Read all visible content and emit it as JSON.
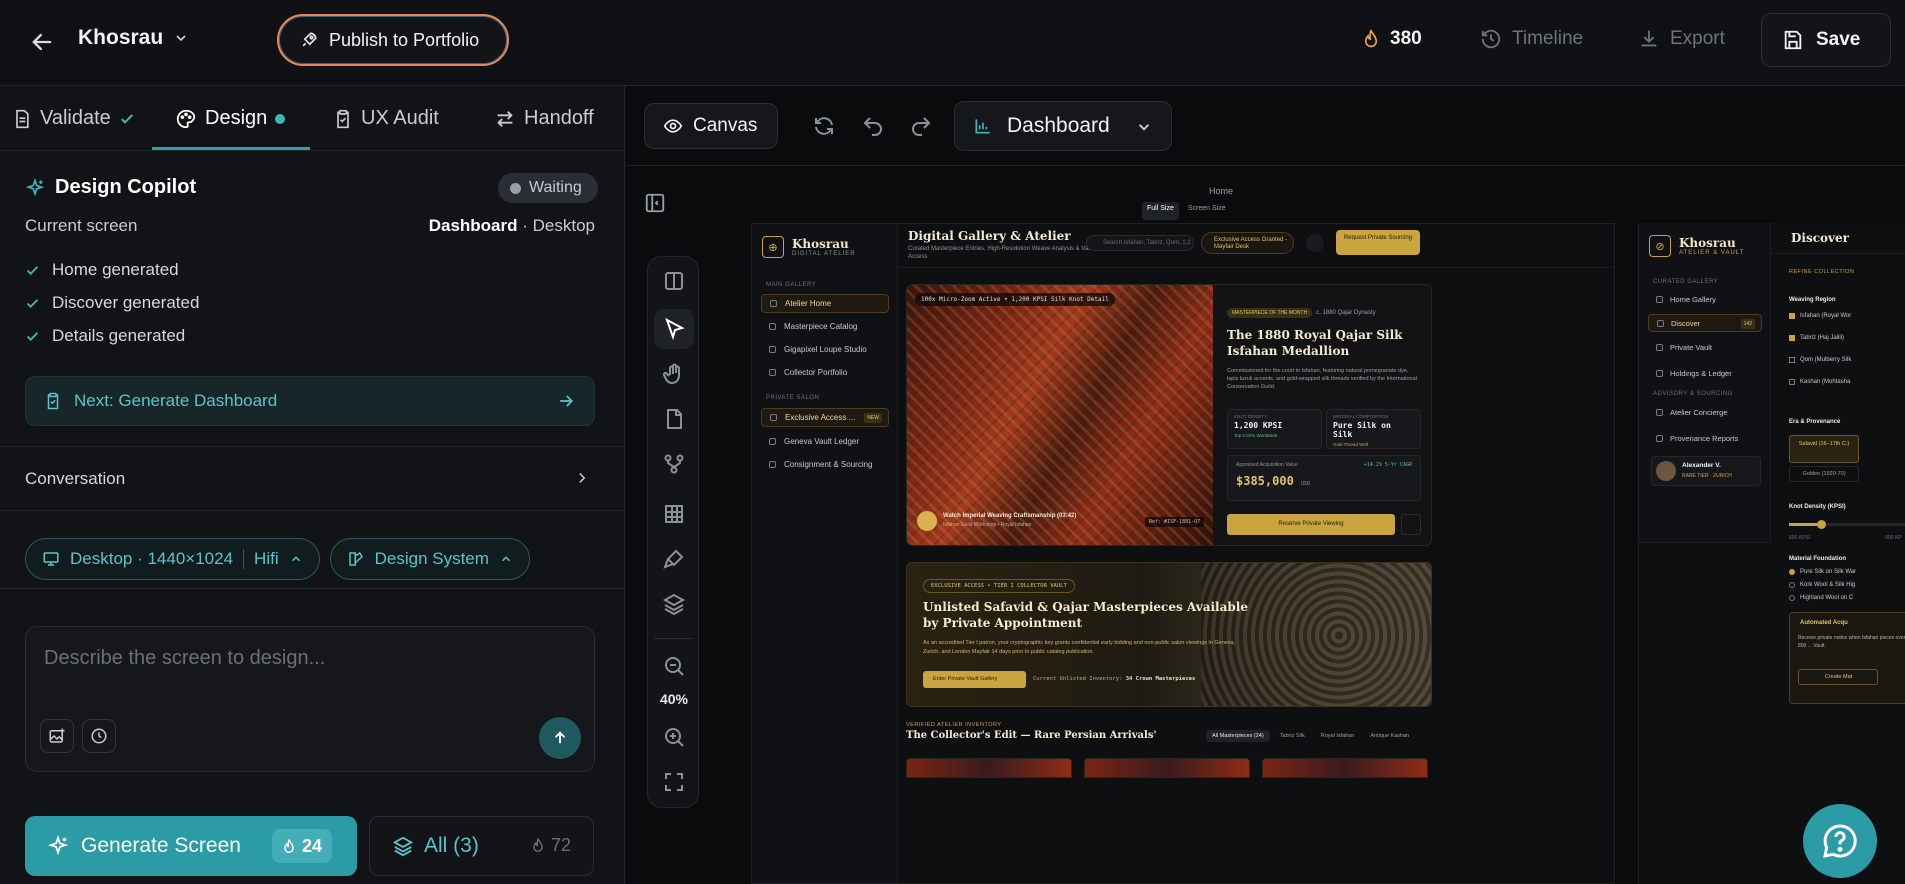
{
  "topbar": {
    "project_name": "Khosrau",
    "publish_label": "Publish to Portfolio",
    "credits": "380",
    "timeline_label": "Timeline",
    "export_label": "Export",
    "save_label": "Save"
  },
  "tabs": [
    {
      "label": "Validate",
      "state": "done"
    },
    {
      "label": "Design",
      "state": "active"
    },
    {
      "label": "UX Audit",
      "state": ""
    },
    {
      "label": "Handoff",
      "state": ""
    }
  ],
  "copilot": {
    "title": "Design Copilot",
    "status": "Waiting",
    "current_screen_label": "Current screen",
    "current_screen_name": "Dashboard",
    "current_screen_device": " · Desktop",
    "steps": [
      "Home generated",
      "Discover generated",
      "Details generated"
    ],
    "next_label": "Next: Generate Dashboard"
  },
  "conversation_label": "Conversation",
  "chips": {
    "device": "Desktop · 1440×1024",
    "fidelity": "Hifi",
    "design_system": "Design System"
  },
  "prompt": {
    "placeholder": "Describe the screen to design..."
  },
  "generate": {
    "label": "Generate Screen",
    "cost": "24"
  },
  "all": {
    "label": "All (3)",
    "cost": "72"
  },
  "canvas": {
    "canvas_label": "Canvas",
    "screen_select": "Dashboard",
    "zoom": "40%",
    "frame_name": "Home",
    "frame_sizes": [
      "Full Size",
      "Screen Size"
    ]
  },
  "mock_home": {
    "brand": "Khosrau",
    "brand_sub": "DIGITAL ATELIER",
    "section_main": "MAIN GALLERY",
    "nav_main": [
      "Atelier Home",
      "Masterpiece Catalog",
      "Gigapixel Loupe Studio",
      "Collector Portfolio"
    ],
    "section_private": "PRIVATE SALON",
    "nav_private": [
      "Exclusive Access ...",
      "Geneva Vault Ledger",
      "Consignment & Sourcing"
    ],
    "private_tag": "NEW",
    "title": "Digital Gallery & Atelier",
    "subtitle": "Curated Masterpiece Entries, High-Resolution Weave Analysis & Vault Access",
    "search_placeholder": "Search Isfahan, Tabriz, Qum, 1,2",
    "exclusive_badge": "Exclusive Access Granted - Mayfair Desk",
    "request_btn": "Request Private Sourcing",
    "hero_badge": "100x Micro-Zoom Active • 1,200 KPSI Silk Knot Detail",
    "hero_pill": "MASTERPIECE OF THE MONTH",
    "hero_era": "c. 1880 Qajar Dynasty",
    "hero_title": "The 1880 Royal Qajar Silk Isfahan Medallion",
    "hero_desc": "Commissioned for the court in Isfahan, featuring natural pomegranate dye, lapis lazuli accents, and gold-wrapped silk threads verified by the International Conservation Guild.",
    "stat1_label": "KNOT DENSITY",
    "stat1_value": "1,200 KPSI",
    "stat1_sub": "Top 0.01% Worldwide",
    "stat2_label": "MATERIAL COMPOSITION",
    "stat2_value": "Pure Silk on Silk",
    "stat2_sub": "Gold Thread Weft",
    "value_label": "Appraised Acquisition Value",
    "value_cagr": "+14.2% 5-Yr CAGR",
    "value_amount": "$385,000",
    "value_unit": "USD",
    "reserve_btn": "Reserve Private Viewing",
    "video_title": "Watch Imperial Weaving Craftsmanship (03:42)",
    "video_sub": "Isfahan Guild Workshop • Royal Isfahan",
    "ref": "Ref: #ISF-1881-Q7",
    "promo_tag": "EXCLUSIVE ACCESS • TIER I COLLECTOR VAULT",
    "promo_title": "Unlisted Safavid & Qajar Masterpieces Available by Private Appointment",
    "promo_desc": "As an accredited Tier I patron, your cryptographic key grants confidential early bidding and non-public salon viewings in Geneva, Zurich, and London Mayfair 14 days prior to public catalog publication.",
    "promo_btn": "Enter Private Vault Gallery",
    "promo_inv_label": "Current Unlisted Inventory:",
    "promo_inv_value": "34 Crown Masterpieces",
    "verified_label": "VERIFIED ATELIER INVENTORY",
    "edit_title": "The Collector's Edit — Rare Persian Arrivals'",
    "filters": [
      "All Masterpieces (24)",
      "Tabriz Silk",
      "Royal Isfahan",
      "Antique Kashan"
    ]
  },
  "mock_discover": {
    "brand": "Khosrau",
    "brand_sub": "ATELIER & VAULT",
    "section_curated": "CURATED GALLERY",
    "nav_curated": [
      "Home Gallery",
      "Discover",
      "Private Vault",
      "Holdings & Ledger"
    ],
    "discover_tag": "142",
    "section_advisory": "ADVISORY & SOURCING",
    "nav_advisory": [
      "Atelier Concierge",
      "Provenance Reports"
    ],
    "user_name": "Alexander V.",
    "user_tier": "RARE TIER · ZURICH",
    "title": "Discover",
    "refine": "REFINE COLLECTION",
    "weaving_region": "Weaving Region",
    "regions": [
      "Isfahan (Royal Wor",
      "Tabriz (Haj Jalili)",
      "Qom (Mulberry Silk",
      "Kashan (Mohtasha"
    ],
    "era_label": "Era & Provenance",
    "era_selected": "Safavid (16–17th C.)",
    "era_other": "Golden (1920-70)",
    "knot_label": "Knot Density (KPSI)",
    "knot_min": "600 KPSI",
    "knot_max": "800 KP",
    "material_label": "Material Foundation",
    "materials": [
      "Pure Silk on Silk War",
      "Kork Wool & Silk Hig",
      "Highland Wool on C"
    ],
    "auto_title": "Automated Acqu",
    "auto_desc": "Receive private notice when Isfahan pieces over 800 ... Vault.",
    "auto_btn": "Create Mat"
  }
}
